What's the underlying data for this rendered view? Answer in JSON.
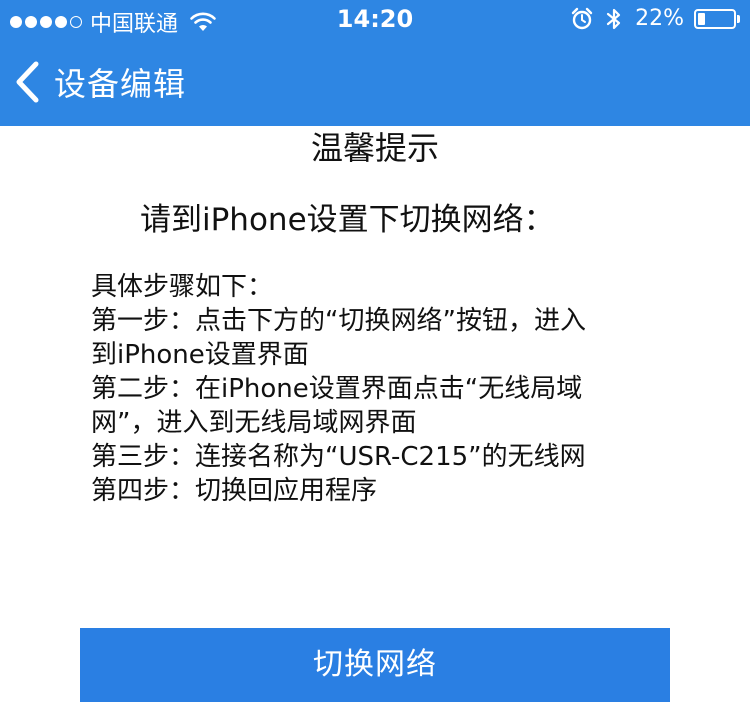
{
  "status_bar": {
    "signal_bars": "●●●●○",
    "carrier": "中国联通",
    "time": "14:20",
    "battery_percent": "22%",
    "battery_level": 0.22,
    "icons": [
      "wifi-icon",
      "alarm-icon",
      "bluetooth-icon",
      "battery-icon"
    ]
  },
  "nav": {
    "back_icon": "chevron-left-icon",
    "title": "设备编辑"
  },
  "tip": {
    "title": "温馨提示",
    "instruction": "请到iPhone设置下切换网络：",
    "steps": [
      "具体步骤如下：",
      "第一步：点击下方的“切换网络”按钮，进入",
      "到iPhone设置界面",
      "第二步：在iPhone设置界面点击“无线局域",
      "网”，进入到无线局域网界面",
      "第三步：连接名称为“USR-C215”的无线网",
      "第四步：切换回应用程序"
    ]
  },
  "button": {
    "label": "切换网络"
  },
  "colors": {
    "header_bg": "#2e86e3",
    "button_bg": "#2a7fe3",
    "text": "#111111",
    "background": "#ffffff"
  }
}
